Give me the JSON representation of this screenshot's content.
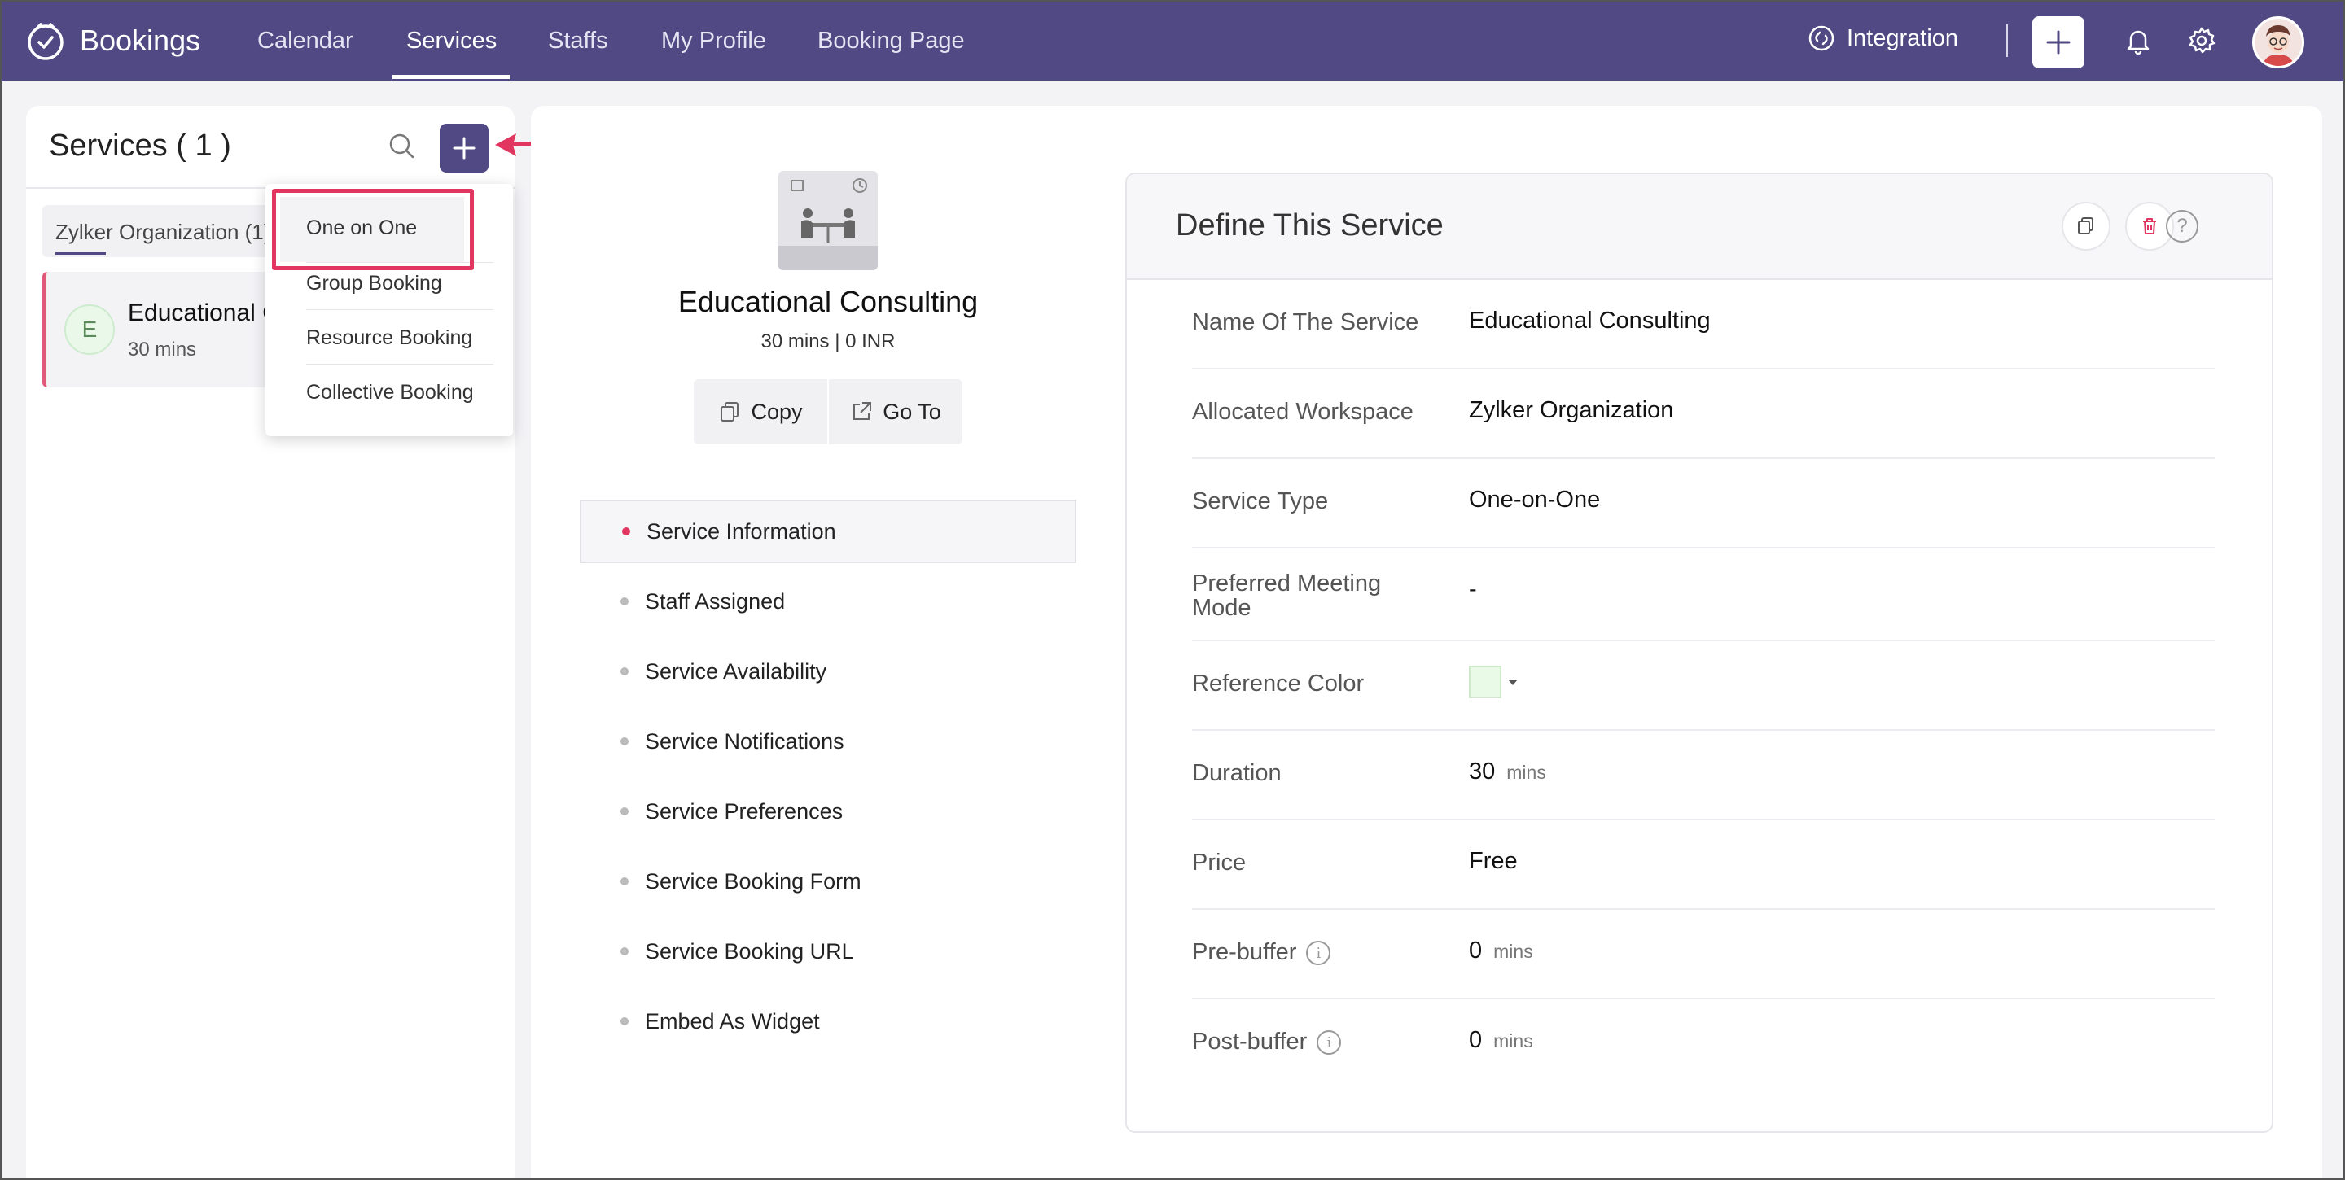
{
  "app": {
    "name": "Bookings"
  },
  "nav": {
    "items": [
      {
        "label": "Calendar"
      },
      {
        "label": "Services"
      },
      {
        "label": "Staffs"
      },
      {
        "label": "My Profile"
      },
      {
        "label": "Booking Page"
      }
    ],
    "active": "Services",
    "integration_label": "Integration"
  },
  "left_panel": {
    "title": "Services ( 1 )",
    "org_tab": "Zylker Organization (1)",
    "service": {
      "initial": "E",
      "name": "Educational Consulting",
      "duration": "30 mins",
      "accent_color": "#e0587a"
    }
  },
  "dropdown": {
    "items": [
      "One on One",
      "Group Booking",
      "Resource Booking",
      "Collective Booking"
    ],
    "highlighted": "One on One",
    "highlight_color": "#e0365f"
  },
  "service_summary": {
    "title": "Educational Consulting",
    "meta": "30 mins | 0 INR",
    "copy_label": "Copy",
    "goto_label": "Go To"
  },
  "side_nav": {
    "items": [
      "Service Information",
      "Staff Assigned",
      "Service Availability",
      "Service Notifications",
      "Service Preferences",
      "Service Booking Form",
      "Service Booking URL",
      "Embed As Widget"
    ],
    "active": "Service Information"
  },
  "define": {
    "title": "Define This Service",
    "help_symbol": "?",
    "rows": {
      "name": {
        "label": "Name Of The Service",
        "value": "Educational Consulting"
      },
      "workspace": {
        "label": "Allocated Workspace",
        "value": "Zylker Organization"
      },
      "type": {
        "label": "Service Type",
        "value": "One-on-One"
      },
      "mode": {
        "label1": "Preferred Meeting",
        "label2": "Mode",
        "value": "-"
      },
      "color": {
        "label": "Reference Color",
        "value": "#e9fbe6"
      },
      "duration": {
        "label": "Duration",
        "value": "30",
        "unit": "mins"
      },
      "price": {
        "label": "Price",
        "value": "Free"
      },
      "prebuffer": {
        "label": "Pre-buffer",
        "value": "0",
        "unit": "mins"
      },
      "postbuffer": {
        "label": "Post-buffer",
        "value": "0",
        "unit": "mins"
      }
    }
  },
  "colors": {
    "brand": "#514983",
    "accent": "#e0365f"
  },
  "icons": [
    "bookings-logo-icon",
    "integration-icon",
    "plus-icon",
    "bell-icon",
    "gear-icon",
    "search-icon",
    "copy-icon",
    "external-link-icon",
    "trash-icon",
    "help-icon",
    "info-icon"
  ]
}
